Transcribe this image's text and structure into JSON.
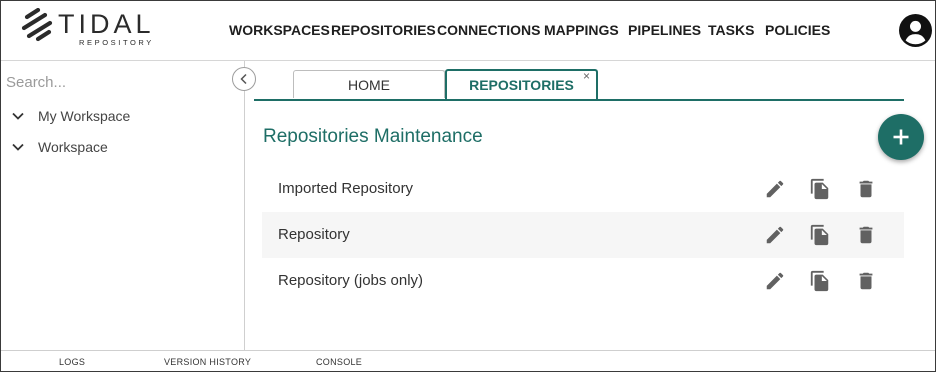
{
  "brand": {
    "name": "TIDAL",
    "subtitle": "REPOSITORY"
  },
  "nav": {
    "items": [
      "WORKSPACES",
      "REPOSITORIES",
      "CONNECTIONS",
      "MAPPINGS",
      "PIPELINES",
      "TASKS",
      "POLICIES"
    ]
  },
  "sidebar": {
    "search_placeholder": "Search...",
    "tree": [
      {
        "label": "My Workspace",
        "icon": "chevron-down-icon"
      },
      {
        "label": "Workspace",
        "icon": "chevron-down-icon"
      }
    ]
  },
  "tabs": [
    {
      "label": "HOME",
      "active": false
    },
    {
      "label": "REPOSITORIES",
      "active": true,
      "close": "×"
    }
  ],
  "main": {
    "title": "Repositories Maintenance",
    "add_icon": "plus-icon",
    "rows": [
      {
        "name": "Imported Repository"
      },
      {
        "name": "Repository"
      },
      {
        "name": "Repository (jobs only)"
      }
    ],
    "row_actions": [
      "edit-icon",
      "copy-icon",
      "delete-icon"
    ]
  },
  "footer": {
    "items": [
      "LOGS",
      "VERSION HISTORY",
      "CONSOLE"
    ]
  },
  "colors": {
    "accent": "#1e6e66",
    "text": "#333333",
    "icon": "#616161",
    "row_alt": "#f6f6f6"
  }
}
